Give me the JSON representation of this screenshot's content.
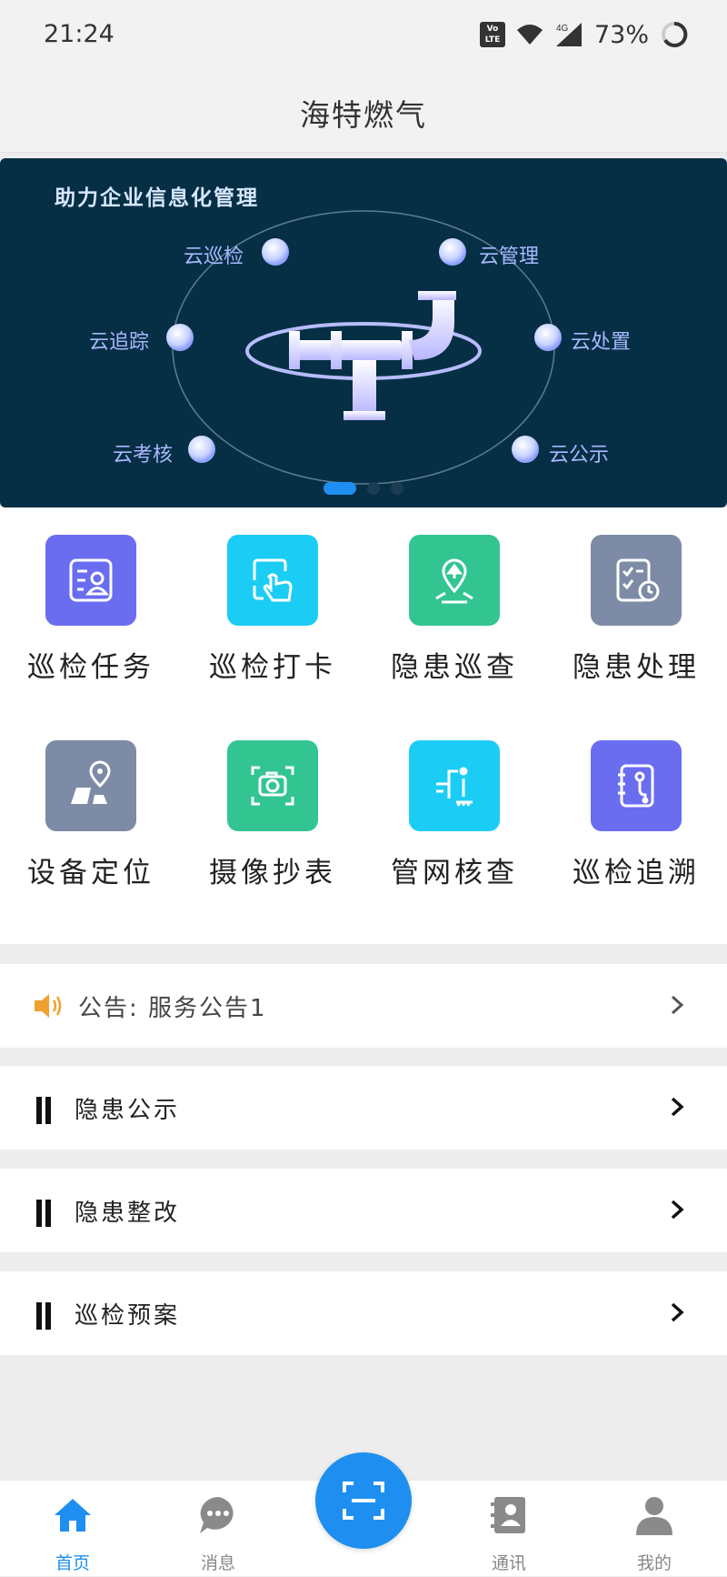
{
  "status_bar": {
    "time": "21:24",
    "battery": "73%",
    "network": "4G"
  },
  "header": {
    "title": "海特燃气"
  },
  "banner": {
    "headline": "助力企业信息化管理",
    "nodes": [
      "云巡检",
      "云管理",
      "云追踪",
      "云处置",
      "云考核",
      "云公示"
    ],
    "page_count": 3,
    "active_page": 1
  },
  "grid": {
    "items": [
      {
        "label": "巡检任务",
        "icon": "task-icon",
        "color": "#6a6df0"
      },
      {
        "label": "巡检打卡",
        "icon": "tap-checkin-icon",
        "color": "#1bcdf5"
      },
      {
        "label": "隐患巡查",
        "icon": "hazard-inspect-icon",
        "color": "#33c591"
      },
      {
        "label": "隐患处理",
        "icon": "hazard-handle-icon",
        "color": "#7e8ba6"
      },
      {
        "label": "设备定位",
        "icon": "device-location-icon",
        "color": "#7e8ba6"
      },
      {
        "label": "摄像抄表",
        "icon": "camera-meter-icon",
        "color": "#33c591"
      },
      {
        "label": "管网核查",
        "icon": "pipe-check-icon",
        "color": "#1bcdf5"
      },
      {
        "label": "巡检追溯",
        "icon": "trace-icon",
        "color": "#6a6df0"
      }
    ]
  },
  "notice": {
    "text": "公告: 服务公告1",
    "icon": "speaker-icon",
    "icon_color": "#f0a030"
  },
  "sections": [
    {
      "label": "隐患公示"
    },
    {
      "label": "隐患整改"
    },
    {
      "label": "巡检预案"
    }
  ],
  "tabbar": {
    "items": [
      {
        "label": "首页",
        "icon": "home-icon",
        "active": true
      },
      {
        "label": "消息",
        "icon": "message-icon",
        "active": false
      },
      {
        "label": "通讯",
        "icon": "contacts-icon",
        "active": false
      },
      {
        "label": "我的",
        "icon": "profile-icon",
        "active": false
      }
    ],
    "scan_icon": "scan-icon"
  },
  "colors": {
    "accent": "#1e8ff0",
    "banner_bg": "#062f45"
  }
}
